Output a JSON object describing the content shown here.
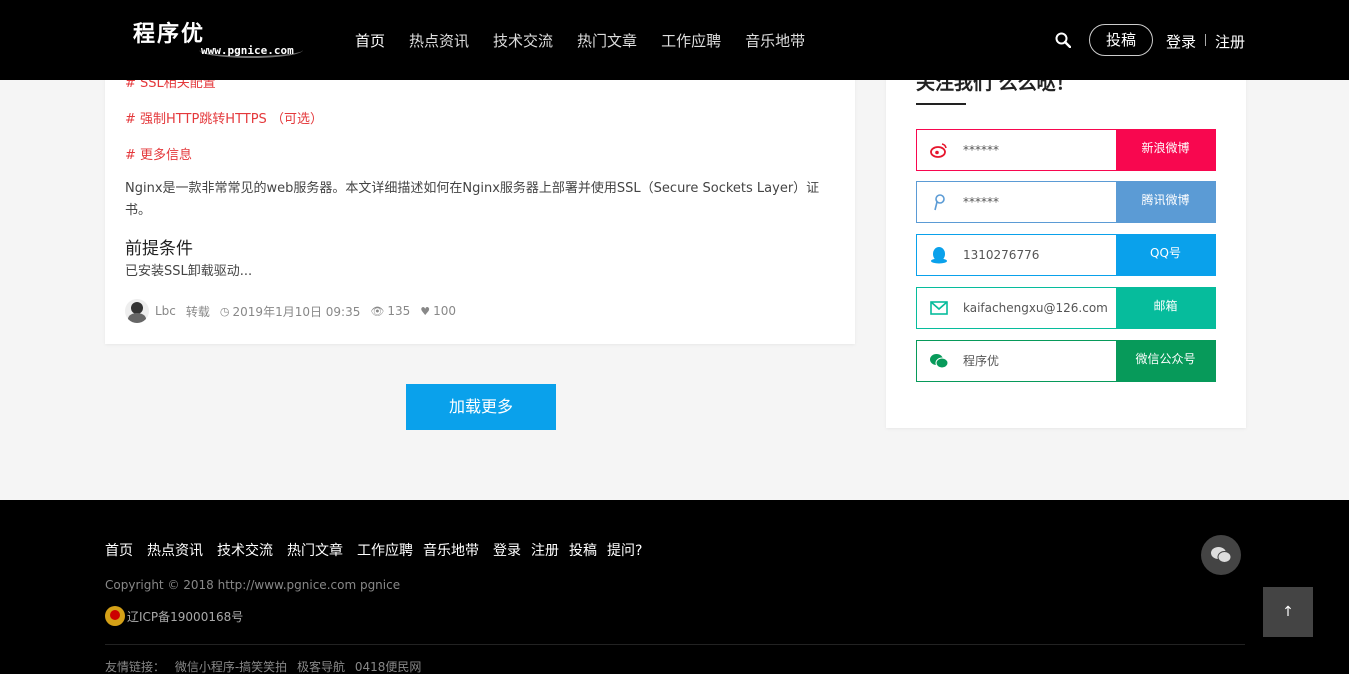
{
  "header": {
    "logo_cn": "程序优",
    "logo_en": "www.pgnice.com",
    "nav": [
      {
        "label": "首页",
        "active": true
      },
      {
        "label": "热点资讯",
        "active": false
      },
      {
        "label": "技术交流",
        "active": false
      },
      {
        "label": "热门文章",
        "active": false
      },
      {
        "label": "工作应聘",
        "active": false
      },
      {
        "label": "音乐地带",
        "active": false
      }
    ],
    "search_icon": "search-icon",
    "contribute": "投稿",
    "login": "登录",
    "register": "注册"
  },
  "article": {
    "toc": [
      "# SSL相关配置",
      "# 强制HTTP跳转HTTPS （可选）",
      "# 更多信息"
    ],
    "excerpt": "Nginx是一款非常常见的web服务器。本文详细描述如何在Nginx服务器上部署并使用SSL（Secure Sockets Layer）证书。",
    "heading": "前提条件",
    "sub": "已安装SSL卸载驱动...",
    "meta": {
      "author": "Lbc",
      "type": "转载",
      "date": "2019年1月10日 09:35",
      "views": "135",
      "likes": "100"
    }
  },
  "load_more": "加载更多",
  "side": {
    "title": "关注我们 么么哒！",
    "rows": [
      {
        "icon": "weibo-icon",
        "value": "******",
        "label": "新浪微博",
        "color": "#f8074f"
      },
      {
        "icon": "tencent-weibo-icon",
        "value": "******",
        "label": "腾讯微博",
        "color": "#5b9bd5"
      },
      {
        "icon": "qq-icon",
        "value": "1310276776",
        "label": "QQ号",
        "color": "#0aa1eb"
      },
      {
        "icon": "mail-icon",
        "value": "kaifachengxu@126.com",
        "label": "邮箱",
        "color": "#06bc9c"
      },
      {
        "icon": "wechat-icon",
        "value": "程序优",
        "label": "微信公众号",
        "color": "#079a5a"
      }
    ]
  },
  "footer": {
    "links": [
      "首页",
      "热点资讯",
      "技术交流",
      "热门文章",
      "工作应聘",
      "音乐地带",
      "登录",
      "注册",
      "投稿",
      "提问?"
    ],
    "copyright": "Copyright © 2018 http://www.pgnice.com pgnice",
    "icp": "辽ICP备19000168号",
    "friend_label": "友情链接：",
    "friends": [
      "微信小程序-搞笑笑拍",
      "极客导航",
      "0418便民网"
    ],
    "totop": "↑"
  }
}
